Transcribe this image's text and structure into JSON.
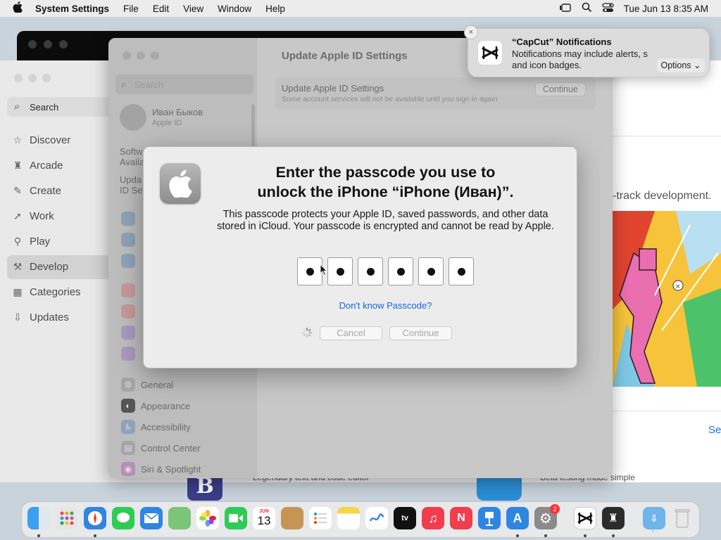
{
  "menubar": {
    "apple_icon": "apple-icon",
    "app_name": "System Settings",
    "menus": [
      "File",
      "Edit",
      "View",
      "Window",
      "Help"
    ],
    "clock": "Tue Jun 13  8:35 AM"
  },
  "appstore": {
    "search_label": "Search",
    "nav": [
      "Discover",
      "Arcade",
      "Create",
      "Work",
      "Play",
      "Develop",
      "Categories",
      "Updates"
    ],
    "selected": "Develop",
    "partial_text": "-track development.",
    "see_link": "Se",
    "below_left": "Legendary text and code editor",
    "below_right": "Beta testing made simple"
  },
  "settings": {
    "title": "Update Apple ID Settings",
    "search_placeholder": "Search",
    "user_name": "Иван Быков",
    "user_sub": "Apple ID",
    "faded_items": [
      "Softw",
      "Availa",
      "Upda",
      "ID Se"
    ],
    "sidebar": [
      "General",
      "Appearance",
      "Accessibility",
      "Control Center",
      "Siri & Spotlight"
    ],
    "card_title": "Update Apple ID Settings",
    "card_sub": "Some account services will not be available until you sign in again",
    "card_button": "Continue"
  },
  "modal": {
    "title": "Enter the passcode you use to unlock the iPhone “iPhone (Иван)”.",
    "body": "This passcode protects your Apple ID, saved passwords, and other data stored in iCloud. Your passcode is encrypted and cannot be read by Apple.",
    "digits_filled": 6,
    "forgot_link": "Don't know Passcode?",
    "cancel": "Cancel",
    "continue": "Continue"
  },
  "notification": {
    "title": "“CapCut” Notifications",
    "body": "Notifications may include alerts, s and icon badges.",
    "options": "Options",
    "close": "×"
  },
  "dock": {
    "calendar_month": "JUN",
    "calendar_day": "13",
    "settings_badge": "2"
  }
}
